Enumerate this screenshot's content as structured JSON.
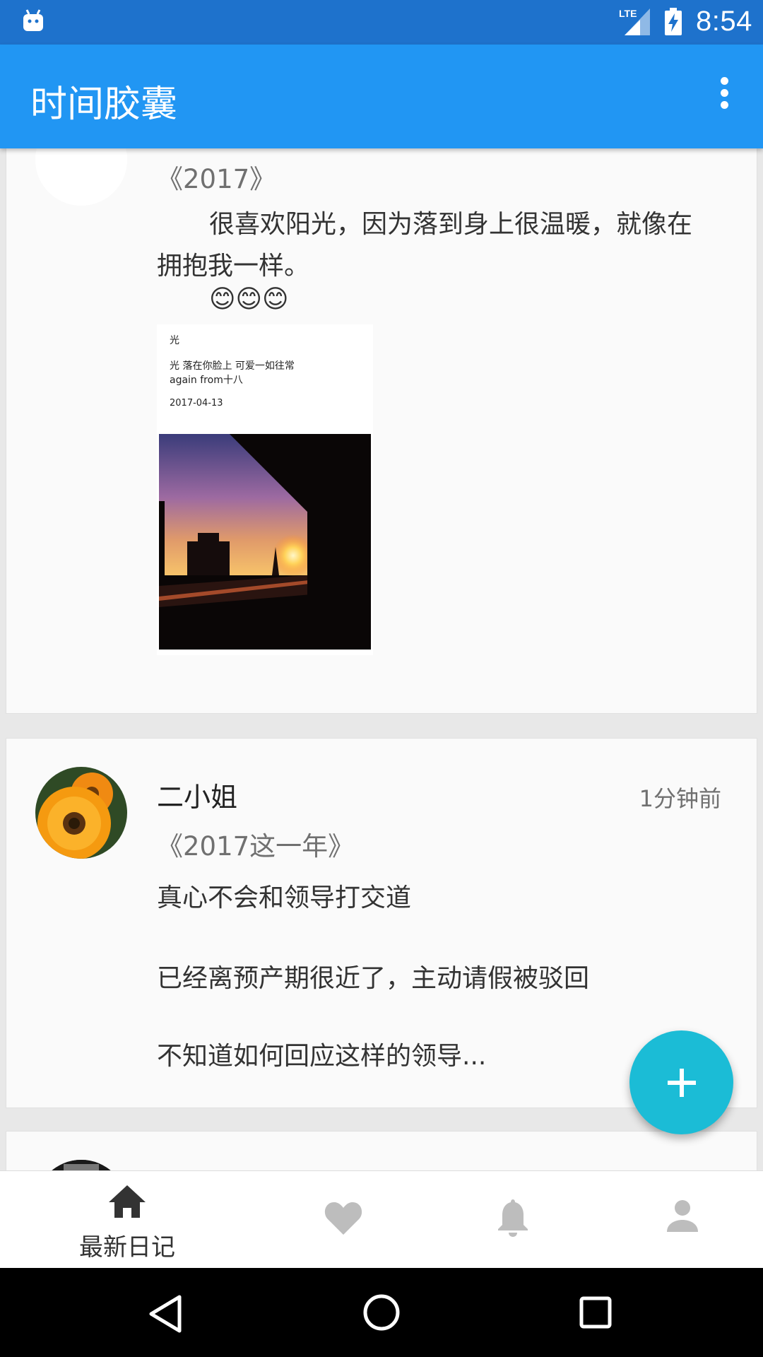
{
  "status_bar": {
    "time": "8:54",
    "network": "LTE"
  },
  "app_bar": {
    "title": "时间胶囊",
    "menu_icon": "more-vert-icon"
  },
  "entries": [
    {
      "diary_title": "《2017》",
      "text_line1": "很喜欢阳光，因为落到身上很温暖，就像在",
      "text_line2": "拥抱我一样。",
      "emoji": "😊😊😊",
      "image": {
        "caption_title": "光",
        "caption_line1": "光 落在你脸上 可爱一如往常",
        "caption_line2": "again from十八",
        "caption_date": "2017-04-13"
      }
    },
    {
      "author": "二小姐",
      "time_ago": "1分钟前",
      "diary_title": "《2017这一年》",
      "para1": "真心不会和领导打交道",
      "para2": "已经离预产期很近了，主动请假被驳回",
      "para3": "不知道如何回应这样的领导..."
    }
  ],
  "bottom_nav": [
    {
      "label": "最新日记",
      "icon": "home-icon",
      "active": true
    },
    {
      "label": "",
      "icon": "heart-icon",
      "active": false
    },
    {
      "label": "",
      "icon": "bell-icon",
      "active": false
    },
    {
      "label": "",
      "icon": "person-icon",
      "active": false
    }
  ],
  "colors": {
    "primary": "#2196f3",
    "status_bar": "#1e72cc",
    "fab": "#1bbcd6",
    "inactive_icon": "#bdbdbd"
  }
}
